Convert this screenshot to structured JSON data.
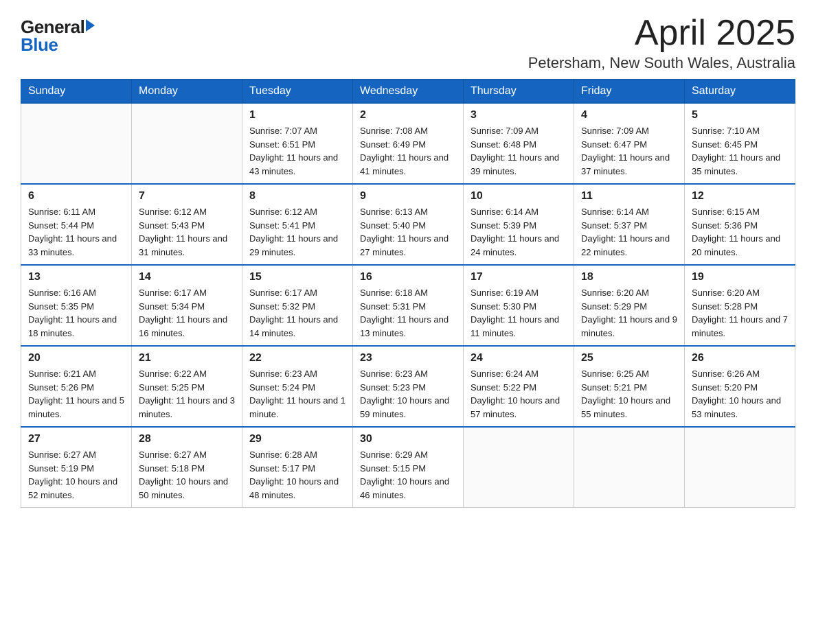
{
  "logo": {
    "general": "General",
    "blue": "Blue"
  },
  "title": "April 2025",
  "subtitle": "Petersham, New South Wales, Australia",
  "weekdays": [
    "Sunday",
    "Monday",
    "Tuesday",
    "Wednesday",
    "Thursday",
    "Friday",
    "Saturday"
  ],
  "weeks": [
    [
      {
        "day": "",
        "sunrise": "",
        "sunset": "",
        "daylight": ""
      },
      {
        "day": "",
        "sunrise": "",
        "sunset": "",
        "daylight": ""
      },
      {
        "day": "1",
        "sunrise": "Sunrise: 7:07 AM",
        "sunset": "Sunset: 6:51 PM",
        "daylight": "Daylight: 11 hours and 43 minutes."
      },
      {
        "day": "2",
        "sunrise": "Sunrise: 7:08 AM",
        "sunset": "Sunset: 6:49 PM",
        "daylight": "Daylight: 11 hours and 41 minutes."
      },
      {
        "day": "3",
        "sunrise": "Sunrise: 7:09 AM",
        "sunset": "Sunset: 6:48 PM",
        "daylight": "Daylight: 11 hours and 39 minutes."
      },
      {
        "day": "4",
        "sunrise": "Sunrise: 7:09 AM",
        "sunset": "Sunset: 6:47 PM",
        "daylight": "Daylight: 11 hours and 37 minutes."
      },
      {
        "day": "5",
        "sunrise": "Sunrise: 7:10 AM",
        "sunset": "Sunset: 6:45 PM",
        "daylight": "Daylight: 11 hours and 35 minutes."
      }
    ],
    [
      {
        "day": "6",
        "sunrise": "Sunrise: 6:11 AM",
        "sunset": "Sunset: 5:44 PM",
        "daylight": "Daylight: 11 hours and 33 minutes."
      },
      {
        "day": "7",
        "sunrise": "Sunrise: 6:12 AM",
        "sunset": "Sunset: 5:43 PM",
        "daylight": "Daylight: 11 hours and 31 minutes."
      },
      {
        "day": "8",
        "sunrise": "Sunrise: 6:12 AM",
        "sunset": "Sunset: 5:41 PM",
        "daylight": "Daylight: 11 hours and 29 minutes."
      },
      {
        "day": "9",
        "sunrise": "Sunrise: 6:13 AM",
        "sunset": "Sunset: 5:40 PM",
        "daylight": "Daylight: 11 hours and 27 minutes."
      },
      {
        "day": "10",
        "sunrise": "Sunrise: 6:14 AM",
        "sunset": "Sunset: 5:39 PM",
        "daylight": "Daylight: 11 hours and 24 minutes."
      },
      {
        "day": "11",
        "sunrise": "Sunrise: 6:14 AM",
        "sunset": "Sunset: 5:37 PM",
        "daylight": "Daylight: 11 hours and 22 minutes."
      },
      {
        "day": "12",
        "sunrise": "Sunrise: 6:15 AM",
        "sunset": "Sunset: 5:36 PM",
        "daylight": "Daylight: 11 hours and 20 minutes."
      }
    ],
    [
      {
        "day": "13",
        "sunrise": "Sunrise: 6:16 AM",
        "sunset": "Sunset: 5:35 PM",
        "daylight": "Daylight: 11 hours and 18 minutes."
      },
      {
        "day": "14",
        "sunrise": "Sunrise: 6:17 AM",
        "sunset": "Sunset: 5:34 PM",
        "daylight": "Daylight: 11 hours and 16 minutes."
      },
      {
        "day": "15",
        "sunrise": "Sunrise: 6:17 AM",
        "sunset": "Sunset: 5:32 PM",
        "daylight": "Daylight: 11 hours and 14 minutes."
      },
      {
        "day": "16",
        "sunrise": "Sunrise: 6:18 AM",
        "sunset": "Sunset: 5:31 PM",
        "daylight": "Daylight: 11 hours and 13 minutes."
      },
      {
        "day": "17",
        "sunrise": "Sunrise: 6:19 AM",
        "sunset": "Sunset: 5:30 PM",
        "daylight": "Daylight: 11 hours and 11 minutes."
      },
      {
        "day": "18",
        "sunrise": "Sunrise: 6:20 AM",
        "sunset": "Sunset: 5:29 PM",
        "daylight": "Daylight: 11 hours and 9 minutes."
      },
      {
        "day": "19",
        "sunrise": "Sunrise: 6:20 AM",
        "sunset": "Sunset: 5:28 PM",
        "daylight": "Daylight: 11 hours and 7 minutes."
      }
    ],
    [
      {
        "day": "20",
        "sunrise": "Sunrise: 6:21 AM",
        "sunset": "Sunset: 5:26 PM",
        "daylight": "Daylight: 11 hours and 5 minutes."
      },
      {
        "day": "21",
        "sunrise": "Sunrise: 6:22 AM",
        "sunset": "Sunset: 5:25 PM",
        "daylight": "Daylight: 11 hours and 3 minutes."
      },
      {
        "day": "22",
        "sunrise": "Sunrise: 6:23 AM",
        "sunset": "Sunset: 5:24 PM",
        "daylight": "Daylight: 11 hours and 1 minute."
      },
      {
        "day": "23",
        "sunrise": "Sunrise: 6:23 AM",
        "sunset": "Sunset: 5:23 PM",
        "daylight": "Daylight: 10 hours and 59 minutes."
      },
      {
        "day": "24",
        "sunrise": "Sunrise: 6:24 AM",
        "sunset": "Sunset: 5:22 PM",
        "daylight": "Daylight: 10 hours and 57 minutes."
      },
      {
        "day": "25",
        "sunrise": "Sunrise: 6:25 AM",
        "sunset": "Sunset: 5:21 PM",
        "daylight": "Daylight: 10 hours and 55 minutes."
      },
      {
        "day": "26",
        "sunrise": "Sunrise: 6:26 AM",
        "sunset": "Sunset: 5:20 PM",
        "daylight": "Daylight: 10 hours and 53 minutes."
      }
    ],
    [
      {
        "day": "27",
        "sunrise": "Sunrise: 6:27 AM",
        "sunset": "Sunset: 5:19 PM",
        "daylight": "Daylight: 10 hours and 52 minutes."
      },
      {
        "day": "28",
        "sunrise": "Sunrise: 6:27 AM",
        "sunset": "Sunset: 5:18 PM",
        "daylight": "Daylight: 10 hours and 50 minutes."
      },
      {
        "day": "29",
        "sunrise": "Sunrise: 6:28 AM",
        "sunset": "Sunset: 5:17 PM",
        "daylight": "Daylight: 10 hours and 48 minutes."
      },
      {
        "day": "30",
        "sunrise": "Sunrise: 6:29 AM",
        "sunset": "Sunset: 5:15 PM",
        "daylight": "Daylight: 10 hours and 46 minutes."
      },
      {
        "day": "",
        "sunrise": "",
        "sunset": "",
        "daylight": ""
      },
      {
        "day": "",
        "sunrise": "",
        "sunset": "",
        "daylight": ""
      },
      {
        "day": "",
        "sunrise": "",
        "sunset": "",
        "daylight": ""
      }
    ]
  ]
}
